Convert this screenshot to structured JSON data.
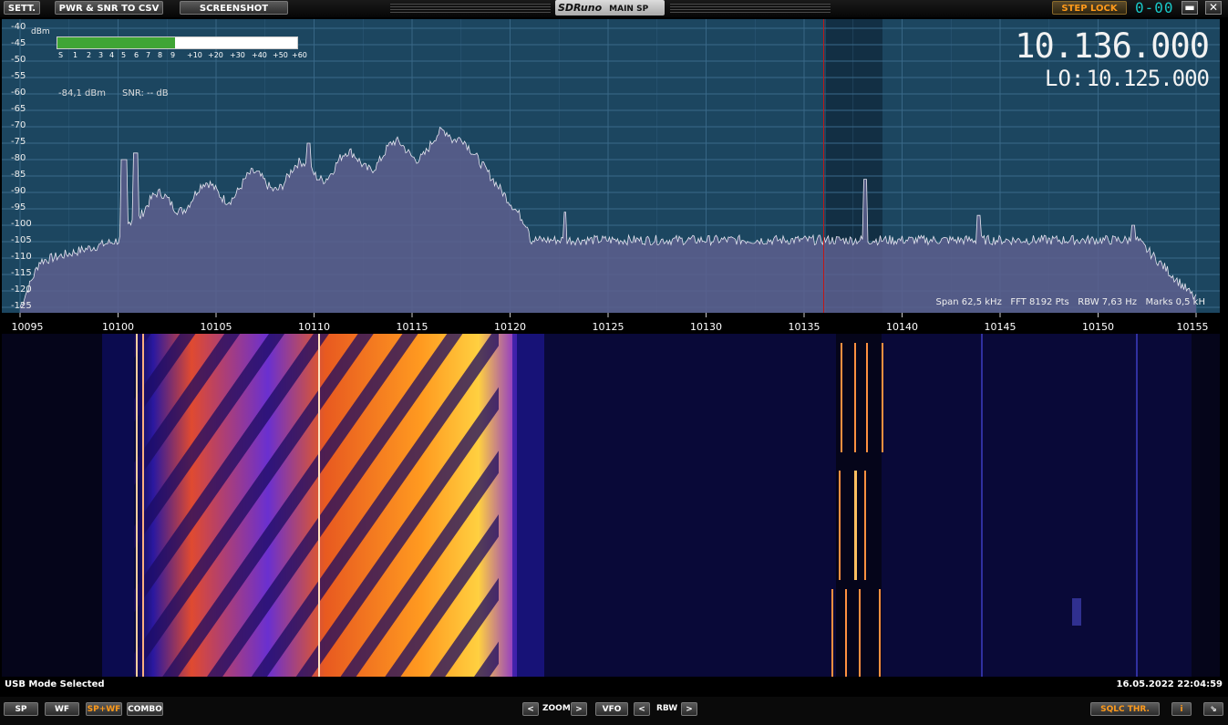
{
  "toolbar": {
    "sett": "SETT.",
    "pwr_snr": "PWR & SNR TO CSV",
    "screenshot": "SCREENSHOT",
    "app_name": "SDRuno",
    "window_name": "MAIN SP",
    "step_lock": "STEP LOCK",
    "mode_indicator": "0-00",
    "minimize": "▬",
    "close": "✕"
  },
  "spectrum": {
    "unit": "dBm",
    "db_scale": [
      "-40",
      "-45",
      "-50",
      "-55",
      "-60",
      "-65",
      "-70",
      "-75",
      "-80",
      "-85",
      "-90",
      "-95",
      "-100",
      "-105",
      "-110",
      "-115",
      "-120",
      "-125"
    ],
    "smeter_labels": [
      "S",
      "1",
      "2",
      "3",
      "4",
      "5",
      "6",
      "7",
      "8",
      "9",
      "+10",
      "+20",
      "+30",
      "+40",
      "+50",
      "+60"
    ],
    "smeter_level_fraction": 0.49,
    "power_reading": "-84,1 dBm",
    "snr_reading": "SNR: -- dB",
    "vfo_frequency": "10.136.000",
    "lo_label": "LO:",
    "lo_frequency": "10.125.000",
    "info": "Span 62,5 kHz   FFT 8192 Pts   RBW 7,63 Hz   Marks 0,5 kH",
    "freq_axis": [
      "10095",
      "10100",
      "10105",
      "10110",
      "10115",
      "10120",
      "10125",
      "10130",
      "10135",
      "10140",
      "10145",
      "10150",
      "10155"
    ],
    "colors": {
      "background": "#1c4660",
      "grid": "#3a6a8a",
      "trace": "#e6e6f0",
      "fill": "#5d5f8e",
      "vfo_line": "#c01818",
      "filter_band": "#2a5c78"
    }
  },
  "status": {
    "mode": "USB Mode Selected",
    "datetime": "16.05.2022 22:04:59"
  },
  "bottom": {
    "sp": "SP",
    "wf": "WF",
    "spwf": "SP+WF",
    "combo": "COMBO",
    "zoom_label": "ZOOM",
    "vfo": "VFO",
    "rbw_label": "RBW",
    "sqlc": "SQLC THR.",
    "info": "i",
    "left_arrow": "<",
    "right_arrow": ">",
    "resize": "⇘"
  }
}
